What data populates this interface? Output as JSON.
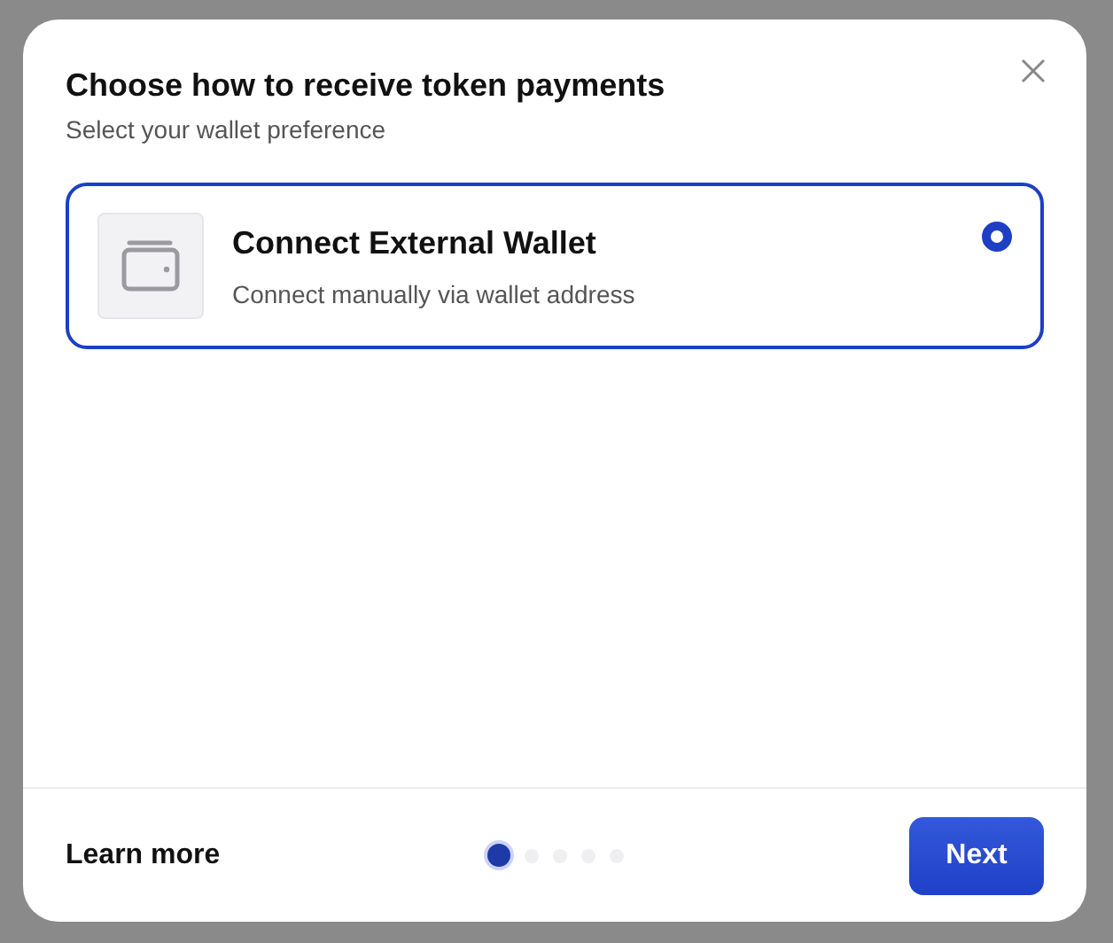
{
  "dialog": {
    "title": "Choose how to receive token payments",
    "subtitle": "Select your wallet preference"
  },
  "options": [
    {
      "title": "Connect External Wallet",
      "description": "Connect manually via wallet address",
      "selected": true
    }
  ],
  "footer": {
    "link": "Learn more",
    "button": "Next"
  },
  "steps": [
    {
      "selected": true
    },
    {
      "selected": false
    },
    {
      "selected": false
    },
    {
      "selected": false
    },
    {
      "selected": false
    }
  ]
}
